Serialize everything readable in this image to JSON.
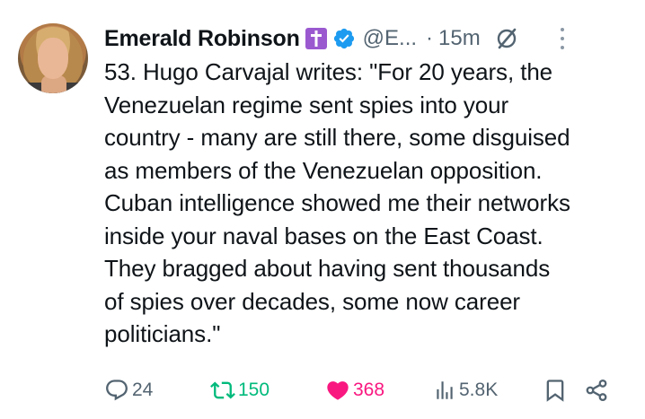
{
  "tweet": {
    "author_name": "Emerald Robinson",
    "handle": "@E...",
    "separator": "·",
    "time_ago": "15m",
    "text_lines": [
      "53. Hugo Carvajal writes: \"For 20 years, the",
      "Venezuelan regime sent spies into your",
      "country - many are still there, some disguised",
      "as members of the Venezuelan opposition.",
      "Cuban intelligence showed me their networks",
      "inside your naval bases on the East Coast.",
      "They bragged about having sent thousands",
      "of spies over decades, some now career",
      "politicians.\""
    ]
  },
  "actions": {
    "replies": "24",
    "reposts": "150",
    "likes": "368",
    "views": "5.8K"
  },
  "icons": {
    "cross_badge": "latin-cross-icon",
    "verified": "verified-badge-icon",
    "grok": "grok-icon",
    "more": "more-vertical-icon",
    "reply": "reply-icon",
    "repost": "repost-icon",
    "like": "heart-icon",
    "views": "views-icon",
    "bookmark": "bookmark-icon",
    "share": "share-icon"
  },
  "colors": {
    "text": "#0f1419",
    "muted": "#536471",
    "verified_blue": "#1d9bf0",
    "repost_green": "#00ba7c",
    "like_pink": "#f91880",
    "cross_purple": "#9b59d0"
  }
}
